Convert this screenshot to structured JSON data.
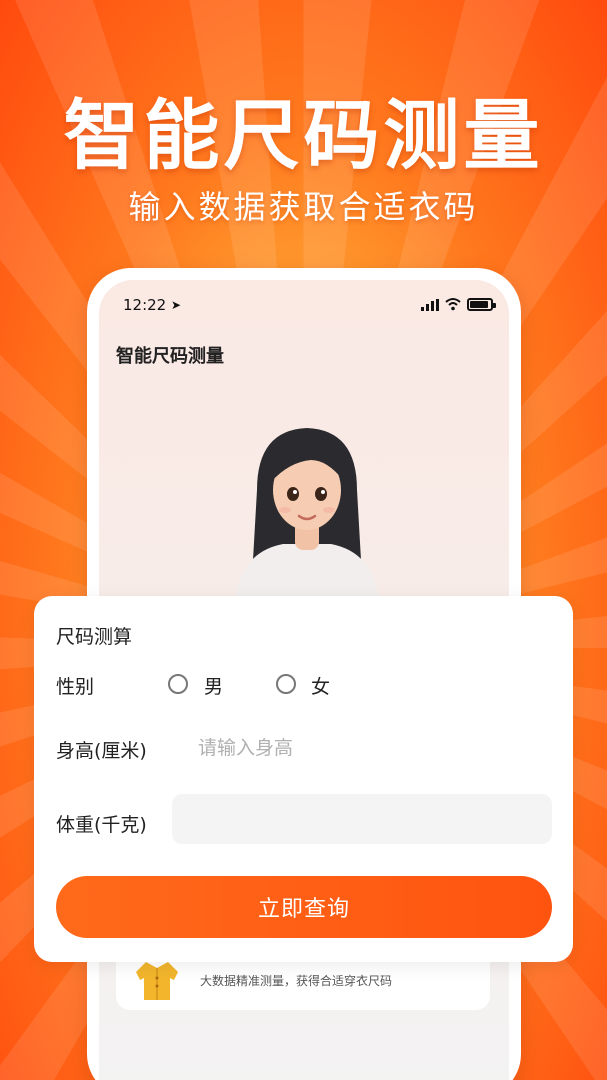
{
  "promo": {
    "title": "智能尺码测量",
    "subtitle": "输入数据获取合适衣码"
  },
  "status_bar": {
    "time": "12:22"
  },
  "screen": {
    "title": "智能尺码测量"
  },
  "form": {
    "title": "尺码测算",
    "gender_label": "性别",
    "gender_options": [
      "男",
      "女"
    ],
    "height_label": "身高(厘米)",
    "height_placeholder": "请输入身高",
    "height_value": "",
    "weight_label": "体重(千克)",
    "weight_value": "",
    "submit_label": "立即查询"
  },
  "info_card": {
    "text": "大数据精准测量，获得合适穿衣尺码"
  },
  "colors": {
    "accent": "#ff5a14",
    "background_top": "#ff4a0e",
    "background_glow": "#ffd26a"
  }
}
